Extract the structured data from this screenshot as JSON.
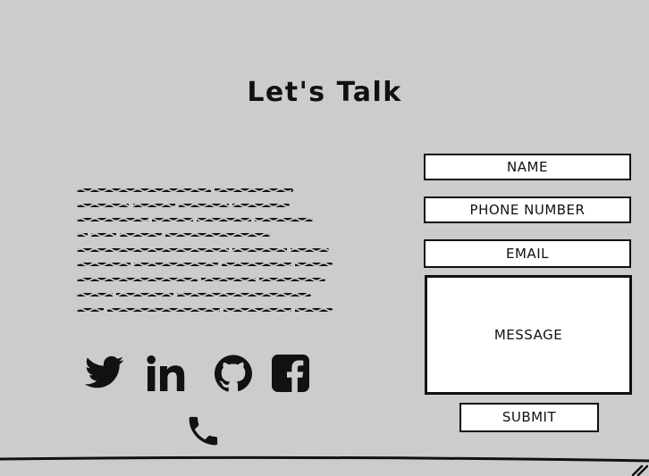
{
  "page": {
    "title": "Let's Talk"
  },
  "social": {
    "twitter_icon": "twitter-icon",
    "linkedin_icon": "linkedin-icon",
    "github_icon": "github-icon",
    "facebook_icon": "facebook-icon",
    "phone_icon": "phone-icon"
  },
  "form": {
    "name_label": "NAME",
    "phone_label": "PHONE NUMBER",
    "email_label": "EMAIL",
    "message_label": "MESSAGE",
    "submit_label": "SUBMIT"
  },
  "colors": {
    "background": "#cccccc",
    "ink": "#111111",
    "field": "#ffffff"
  }
}
